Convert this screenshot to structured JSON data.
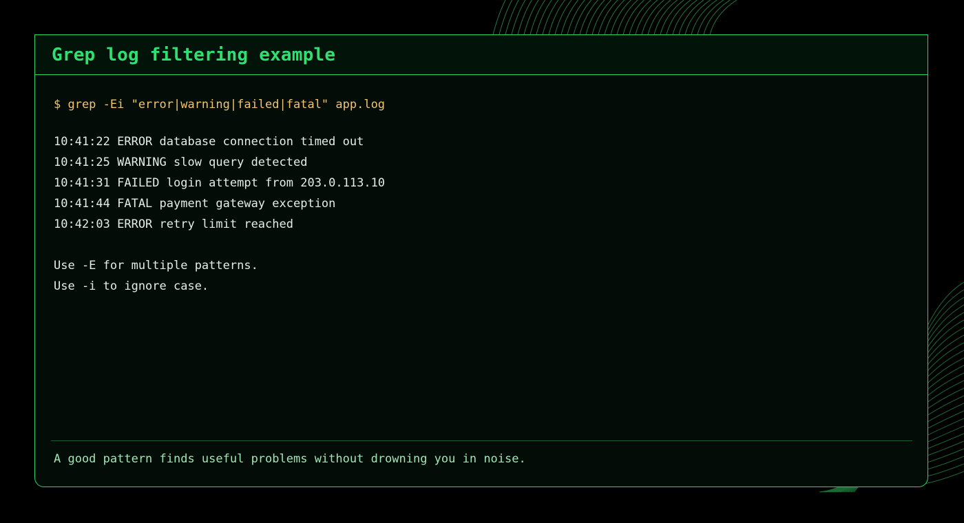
{
  "panel": {
    "title": "Grep log filtering example",
    "command": "$ grep -Ei \"error|warning|failed|fatal\" app.log",
    "output_lines": [
      "10:41:22 ERROR database connection timed out",
      "10:41:25 WARNING slow query detected",
      "10:41:31 FAILED login attempt from 203.0.113.10",
      "10:41:44 FATAL payment gateway exception",
      "10:42:03 ERROR retry limit reached"
    ],
    "notes": [
      "Use -E for multiple patterns.",
      "Use -i to ignore case."
    ],
    "footer": "A good pattern finds useful problems without drowning you in noise."
  },
  "colors": {
    "background": "#000000",
    "accent": "#2fe070",
    "border": "#2fd466",
    "command": "#f2c46e",
    "text": "#e6ece8",
    "footer_text": "#9fe6b5"
  }
}
